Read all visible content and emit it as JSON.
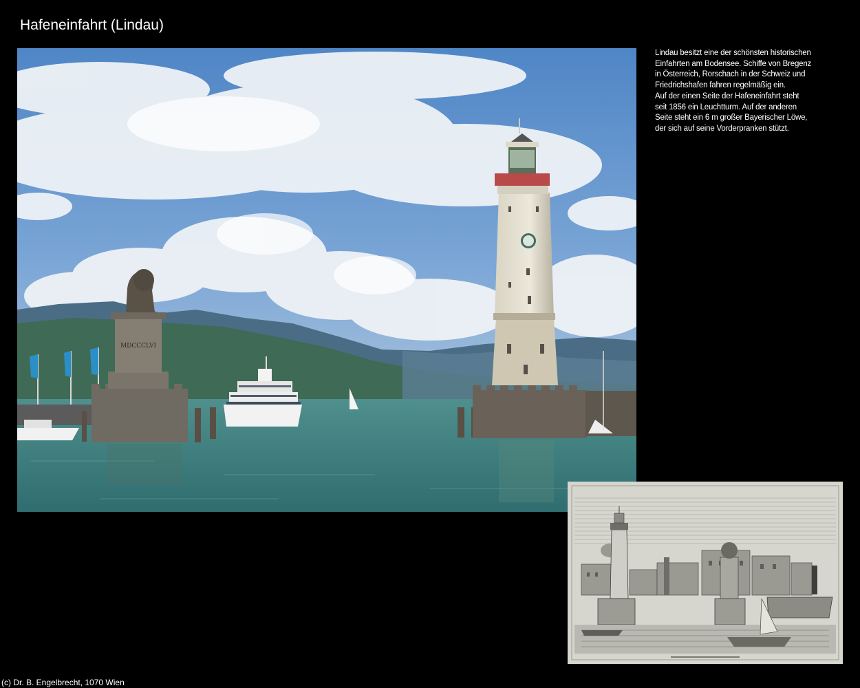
{
  "page": {
    "title": "Hafeneinfahrt (Lindau)"
  },
  "description": {
    "lines": [
      "Lindau besitzt eine der schönsten historischen",
      "Einfahrten am Bodensee. Schiffe von Bregenz",
      "in Österreich, Rorschach in der Schweiz und",
      "Friedrichshafen fahren regelmäßig ein.",
      "Auf der einen Seite der Hafeneinfahrt steht",
      "seit 1856 ein Leuchtturm. Auf der anderen",
      "Seite steht ein 6 m großer Bayerischer Löwe,",
      "der sich auf seine Vorderpranken stützt."
    ]
  },
  "photo": {
    "pedestal_inscription": "MDCCCLVI"
  },
  "footer": {
    "copyright": "(c) Dr. B. Engelbrecht, 1070 Wien"
  },
  "colors": {
    "background": "#000000",
    "text": "#ffffff",
    "sky": "#5d8fc9",
    "lake": "#3e7f80",
    "engraving_paper": "#d8d8cf"
  }
}
